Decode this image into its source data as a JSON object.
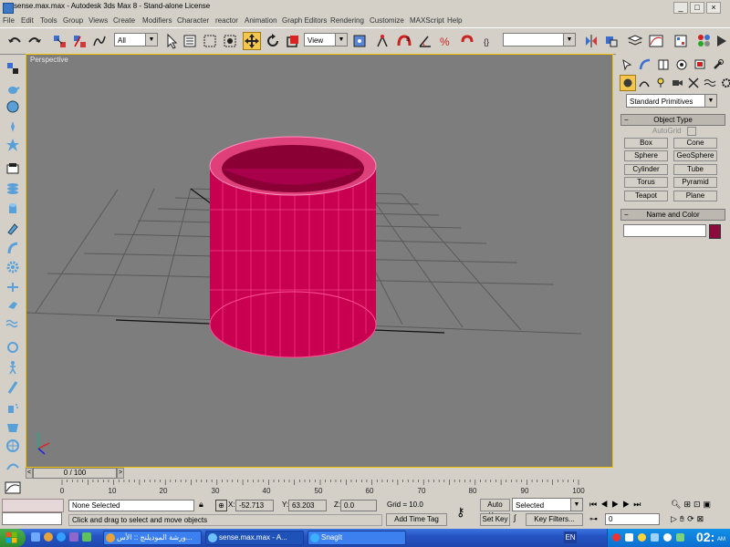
{
  "window": {
    "title": "sense.max.max - Autodesk 3ds Max 8 - Stand-alone License",
    "controls": [
      "_",
      "□",
      "×"
    ]
  },
  "menu": [
    "File",
    "Edit",
    "Tools",
    "Group",
    "Views",
    "Create",
    "Modifiers",
    "Character",
    "reactor",
    "Animation",
    "Graph Editors",
    "Rendering",
    "Customize",
    "MAXScript",
    "Help"
  ],
  "toolbar": {
    "selection_filter": "All",
    "reference_coord": "View",
    "named_selection": ""
  },
  "viewport": {
    "label": "Perspective",
    "object_color": "#c8004f",
    "background": "#7d7d7d"
  },
  "command_panel": {
    "category": "Standard Primitives",
    "object_type_title": "Object Type",
    "autogrid_label": "AutoGrid",
    "buttons": [
      "Box",
      "Cone",
      "Sphere",
      "GeoSphere",
      "Cylinder",
      "Tube",
      "Torus",
      "Pyramid",
      "Teapot",
      "Plane"
    ],
    "name_color_title": "Name and Color",
    "name_value": "",
    "swatch_color": "#8c0a3c"
  },
  "timeline": {
    "frame_label": "0 / 100",
    "ticks": [
      "0",
      "10",
      "20",
      "30",
      "40",
      "50",
      "60",
      "70",
      "80",
      "90",
      "100"
    ]
  },
  "status": {
    "selection": "None Selected",
    "prompt": "Click and drag to select and move objects",
    "x_label": "X:",
    "x_value": "-52.713",
    "y_label": "Y:",
    "y_value": "63.203",
    "z_label": "Z:",
    "z_value": "0.0",
    "grid": "Grid = 10.0",
    "add_time_tag": "Add Time Tag",
    "auto_key": "Auto Key",
    "set_key": "Set Key",
    "key_mode": "Selected",
    "key_filters": "Key Filters...",
    "frame_value": "0"
  },
  "taskbar": {
    "start": "start",
    "tasks": [
      "ورشة الموديلنج :: الأس...",
      "sense.max.max - A...",
      "SnagIt"
    ],
    "lang": "EN",
    "clock": "02:",
    "clock_suffix": "AM"
  }
}
